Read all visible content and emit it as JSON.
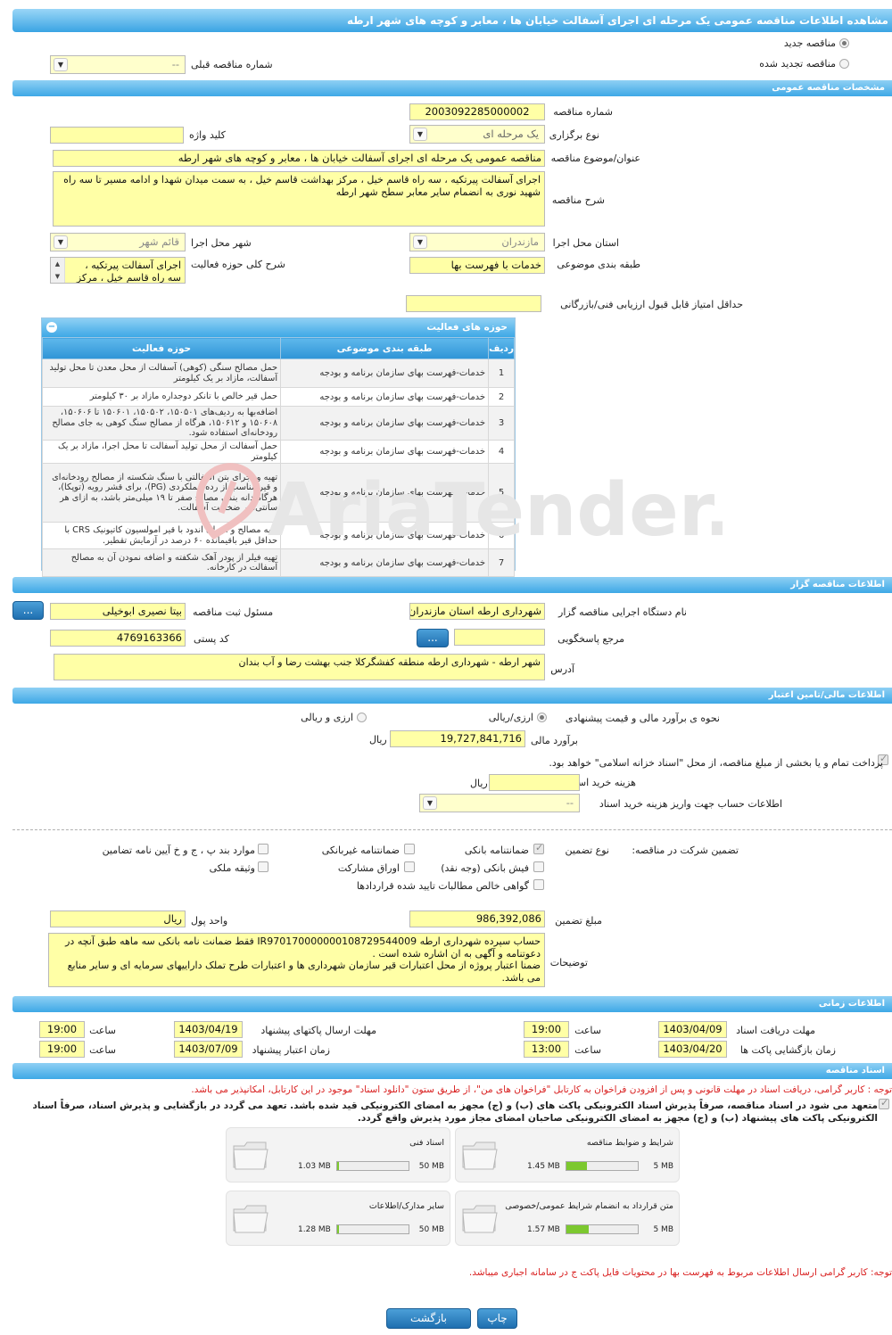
{
  "title": "مشاهده اطلاعات مناقصه عمومی یک مرحله ای اجرای آسفالت خیابان ها ، معابر و کوچه های شهر ارطه",
  "top": {
    "radio_new": "مناقصه جدید",
    "radio_renew": "مناقصه تجدید شده",
    "prev_number_label": "شماره مناقصه قبلی",
    "prev_number_value": "--"
  },
  "general": {
    "header": "مشخصات مناقصه عمومی",
    "number_label": "شماره مناقصه",
    "number_value": "2003092285000002",
    "type_label": "نوع برگزاری",
    "type_value": "یک مرحله ای",
    "keyword_label": "کلید واژه",
    "keyword_value": "",
    "subject_label": "عنوان/موضوع مناقصه",
    "subject_value": "مناقصه عمومی یک مرحله ای اجرای آسفالت خیابان ها ، معابر و کوچه های شهر ارطه",
    "desc_label": "شرح مناقصه",
    "desc_value": "اجرای آسفالت پیرتکیه ، سه راه قاسم خیل ، مرکز بهداشت قاسم خیل ، به سمت میدان شهدا و ادامه مسیر تا سه راه شهید نوری به انضمام سایر معابر سطح شهر ارطه",
    "province_label": "استان محل اجرا",
    "province_value": "مازندران",
    "city_label": "شهر محل اجرا",
    "city_value": "قائم شهر",
    "category_label": "طبقه بندی موضوعی",
    "category_value": "خدمات با فهرست بها",
    "scope_label": "شرح کلی حوزه فعالیت",
    "scope_value": "اجرای آسفالت پیرتکیه ، سه راه قاسم خیل ، مرکز",
    "min_score_label": "حداقل امتیاز قابل قبول ارزیابی فنی/بازرگانی",
    "min_score_value": ""
  },
  "activities": {
    "header": "حوزه های فعالیت",
    "col_row": "ردیف",
    "col_category": "طبقه بندی موضوعی",
    "col_scope": "حوزه فعالیت",
    "rows": [
      {
        "n": "1",
        "cat": "خدمات-فهرست بهای سازمان برنامه و بودجه",
        "scope": "حمل مصالح سنگی (کوهی) آسفالت از محل معدن تا محل تولید آسفالت، مازاد بر یک کیلومتر"
      },
      {
        "n": "2",
        "cat": "خدمات-فهرست بهای سازمان برنامه و بودجه",
        "scope": "حمل قیر خالص با تانکر دوجداره مازاد بر ۳۰ کیلومتر"
      },
      {
        "n": "3",
        "cat": "خدمات-فهرست بهای سازمان برنامه و بودجه",
        "scope": "اضافه‌بها به ردیف‌های ۱۵۰۵۰۱، ۱۵۰۵۰۲، ۱۵۰۶۰۱ تا ۱۵۰۶۰۶، ۱۵۰۶۰۸ و ۱۵۰۶۱۲، هرگاه از مصالح سنگ کوهی به جای مصالح رودخانه‌ای استفاده شود."
      },
      {
        "n": "4",
        "cat": "خدمات-فهرست بهای سازمان برنامه و بودجه",
        "scope": "حمل آسفالت از محل تولید آسفالت تا محل اجرا، مازاد بر یک کیلومتر"
      },
      {
        "n": "5",
        "cat": "خدمات-فهرست بهای سازمان برنامه و بودجه",
        "scope": "تهیه و اجرای بتن آسفالتی با سنگ شکسته از مصالح رودخانه‌ای و قیر مناسب از رده عملکردی (PG)، برای قشر رویه (توپکا)، هرگاه دانه بندی مصالح صفر تا ۱۹ میلی‌متر باشد، به ازای هر سانتی‌متر ضخامت آسفالت."
      },
      {
        "n": "6",
        "cat": "خدمات-فهرست بهای سازمان برنامه و بودجه",
        "scope": "تهیه مصالح و اجرای اندود با قیر امولسیون کاتیونیک CRS با حداقل قیر باقیمانده ۶۰ درصد در آزمایش تقطیر."
      },
      {
        "n": "7",
        "cat": "خدمات-فهرست بهای سازمان برنامه و بودجه",
        "scope": "تهیه فیلر از پودر آهک شکفته و اضافه نمودن آن به مصالح آسفالت در کارخانه."
      }
    ]
  },
  "organizer": {
    "header": "اطلاعات مناقصه گزار",
    "org_label": "نام دستگاه اجرایی مناقصه گزار",
    "org_value": "شهرداری ارطه استان مازندران",
    "official_label": "مسئول ثبت مناقصه",
    "official_value": "بیتا نصیری ابوخیلی",
    "more_button": "...",
    "ref_label": "مرجع پاسخگویی",
    "ref_value": "",
    "postal_label": "کد پستی",
    "postal_value": "4769163366",
    "address_label": "آدرس",
    "address_value": "شهر ارطه - شهرداری ارطه منطقه کفشگرکلا جنب بهشت رضا و آب بندان"
  },
  "finance": {
    "header": "اطلاعات مالی/تامین اعتبار",
    "estimate_method_label": "نحوه ی برآورد مالی و قیمت پیشنهادی",
    "opt_rial": "ارزی/ریالی",
    "opt_fx": "ارزی و ریالی",
    "estimate_label": "برآورد مالی",
    "estimate_value": "19,727,841,716",
    "currency": "ریال",
    "treasury_text": "پرداخت تمام و یا بخشی از مبلغ مناقصه، از محل \"اسناد خزانه اسلامی\" خواهد بود.",
    "doc_fee_label": "هزینه خرید اسناد",
    "doc_fee_value": "",
    "doc_fee_unit": "ریال",
    "account_label": "اطلاعات حساب جهت واریز هزینه خرید اسناد",
    "account_value": "--"
  },
  "guarantee": {
    "section_label": "تضمین شرکت در مناقصه:",
    "type_label": "نوع تضمین",
    "opt_bank": "ضمانتنامه بانکی",
    "opt_nonbank": "ضمانتنامه غیربانکی",
    "opt_clauses": "موارد بند پ ، ج و خ آیین نامه تضامین",
    "opt_cash": "فیش بانکی (وجه نقد)",
    "opt_bonds": "اوراق مشارکت",
    "opt_property": "وثیقه ملکی",
    "opt_claims": "گواهی خالص مطالبات تایید شده قراردادها",
    "amount_label": "مبلغ تضمین",
    "amount_value": "986,392,086",
    "currency_label": "واحد پول",
    "currency_value": "ریال",
    "notes_label": "توضیحات",
    "notes_value": "حساب سپرده شهرداری ارطه IR970170000000108729544009 فقط ضمانت نامه بانکی سه ماهه طبق آنچه در دعوتنامه و آگهی به ان اشاره شده است .\nضمنا اعتبار پروژه از محل اعتبارات قیر سازمان شهرداری ها و اعتبارات طرح تملک داراییهای سرمایه ای و سایر منابع می باشد."
  },
  "timing": {
    "header": "اطلاعات زمانی",
    "receive_label": "مهلت دریافت اسناد",
    "receive_date": "1403/04/09",
    "receive_time": "19:00",
    "submit_label": "مهلت ارسال پاکتهای پیشنهاد",
    "submit_date": "1403/04/19",
    "submit_time": "19:00",
    "open_label": "زمان بازگشایی پاکت ها",
    "open_date": "1403/04/20",
    "open_time": "13:00",
    "validity_label": "زمان اعتبار پیشنهاد",
    "validity_date": "1403/07/09",
    "validity_time": "19:00",
    "time_label": "ساعت"
  },
  "documents": {
    "header": "اسناد مناقصه",
    "note1": "توجه : کاربر گرامی، دریافت اسناد در مهلت قانونی و پس از افزودن فراخوان به کارتابل \"فراخوان های من\"، از طریق ستون \"دانلود اسناد\" موجود در این کارتابل، امکانپذیر می باشد.",
    "pledge": "متعهد می شود در اسناد مناقصه، صرفاً پذیرش اسناد الکترونیکی پاکت های (ب) و (ج) مجهز به امضای الکترونیکی قید شده باشد. تعهد می گردد در بازگشایی و پذیرش اسناد، صرفاً اسناد الکترونیکی پاکت های پیشنهاد (ب) و (ج) مجهز به امضای الکترونیکی صاحبان امضای مجاز مورد پذیرش واقع گردد.",
    "files": [
      {
        "title": "شرایط و ضوابط مناقصه",
        "used": "1.45 MB",
        "max": "5 MB",
        "fill": 0.29
      },
      {
        "title": "اسناد فنی",
        "used": "1.03 MB",
        "max": "50 MB",
        "fill": 0.02
      },
      {
        "title": "متن قرارداد به انضمام شرایط عمومی/خصوصی",
        "used": "1.57 MB",
        "max": "5 MB",
        "fill": 0.31
      },
      {
        "title": "سایر مدارک/اطلاعات",
        "used": "1.28 MB",
        "max": "50 MB",
        "fill": 0.03
      }
    ],
    "note2": "توجه: کاربر گرامی ارسال اطلاعات مربوط به فهرست بها در محتویات فایل پاکت ج در سامانه اجباری میباشد."
  },
  "footer": {
    "print_button": "چاپ",
    "back_button": "بازگشت"
  },
  "watermark": "AriaTender.neT"
}
